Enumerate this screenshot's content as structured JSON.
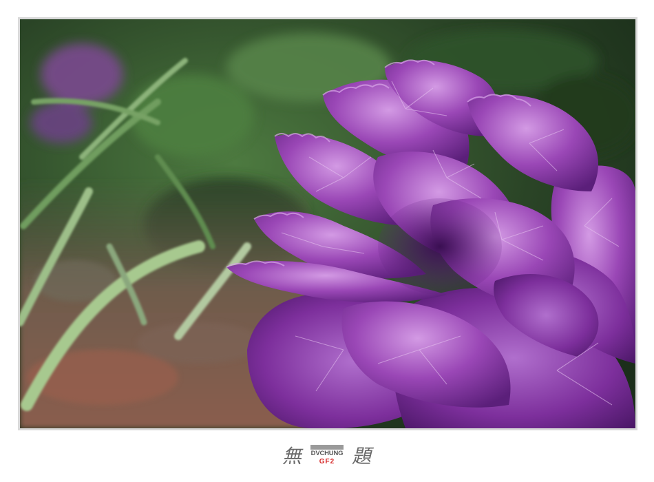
{
  "signature": {
    "left_glyph": "無",
    "right_glyph": "題",
    "logo_name": "DVCHUNG",
    "logo_tag": "GF2"
  },
  "colors": {
    "frame_border": "#d9d9d9",
    "foliage_dark": "#243d22",
    "foliage_mid": "#3f6b35",
    "ground": "#7a5a4c",
    "petal_dark": "#5b1f7a",
    "petal_mid": "#8a3aa6",
    "petal_light": "#c48ad8",
    "logo_red": "#d62828"
  }
}
